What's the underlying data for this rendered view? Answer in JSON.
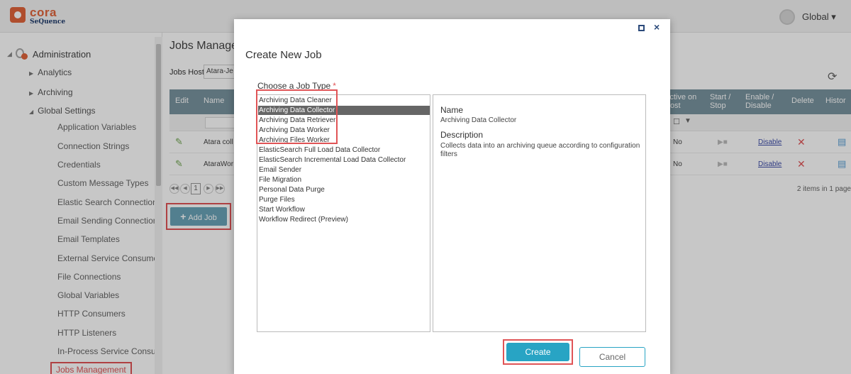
{
  "brand": {
    "name": "cora",
    "sub": "SeQuence"
  },
  "user_menu": {
    "label": "Global ▾"
  },
  "sidebar": {
    "root": "Administration",
    "sections": [
      "Analytics",
      "Archiving",
      "Global Settings"
    ],
    "items": [
      "Application Variables",
      "Connection Strings",
      "Credentials",
      "Custom Message Types",
      "Elastic Search Connections",
      "Email Sending Connections",
      "Email Templates",
      "External Service Consumers",
      "File Connections",
      "Global Variables",
      "HTTP Consumers",
      "HTTP Listeners",
      "In-Process Service Consume",
      "Jobs Management"
    ]
  },
  "main": {
    "title": "Jobs Manage",
    "jobs_host_label": "Jobs Host",
    "jobs_host_value": "Atara-Je",
    "columns": {
      "edit": "Edit",
      "name": "Name",
      "active": "Active on Host",
      "startstop": "Start / Stop",
      "enable": "Enable / Disable",
      "delete": "Delete",
      "history": "Histor"
    },
    "rows": [
      {
        "name": "Atara coll",
        "active": "No",
        "action": "Disable"
      },
      {
        "name": "AtaraWor",
        "active": "No",
        "action": "Disable"
      }
    ],
    "pager": {
      "page": "1",
      "count": "2 items in 1 page"
    },
    "add_job": "Add Job"
  },
  "modal": {
    "title": "Create New Job",
    "choose_label": "Choose a Job Type",
    "required_mark": "*",
    "job_types": [
      "Archiving Data Cleaner",
      "Archiving Data Collector",
      "Archiving Data Retriever",
      "Archiving Data Worker",
      "Archiving Files Worker",
      "ElasticSearch Full Load Data Collector",
      "ElasticSearch Incremental Load Data Collector",
      "Email Sender",
      "File Migration",
      "Personal Data Purge",
      "Purge Files",
      "Start Workflow",
      "Workflow Redirect (Preview)"
    ],
    "selected_index": 1,
    "detail": {
      "name_label": "Name",
      "name_value": "Archiving Data Collector",
      "desc_label": "Description",
      "desc_value": "Collects data into an archiving queue according to configuration filters"
    },
    "create": "Create",
    "cancel": "Cancel"
  }
}
